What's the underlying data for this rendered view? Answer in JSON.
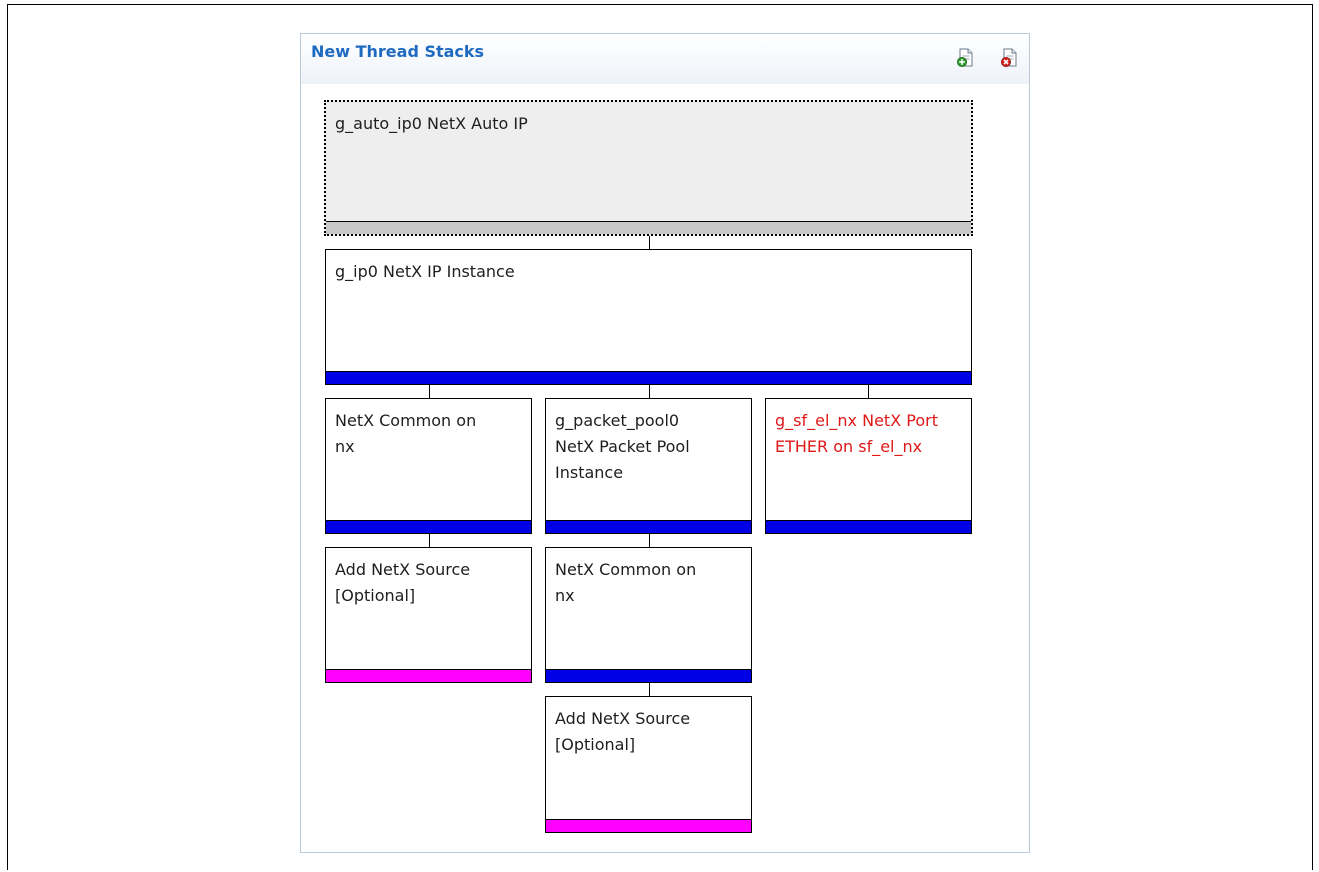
{
  "panel": {
    "title": "New Thread Stacks",
    "icons": [
      "add-stack-icon",
      "remove-stack-icon"
    ]
  },
  "colors": {
    "bar_required": "#0000e6",
    "bar_optional": "#ff00ff",
    "bar_selected": "#c8c8c8",
    "error_text": "#e01818",
    "title": "#1f6bc1"
  },
  "stacks": [
    {
      "label": "g_auto_ip0 NetX Auto IP",
      "bar": "selected"
    },
    {
      "label": "g_ip0 NetX IP Instance",
      "bar": "required"
    },
    {
      "label": "NetX Common on\nnx",
      "bar": "required"
    },
    {
      "label": "g_packet_pool0\nNetX Packet Pool\nInstance",
      "bar": "required"
    },
    {
      "label": "g_sf_el_nx NetX Port\nETHER on sf_el_nx",
      "bar": "required",
      "error": true
    },
    {
      "label": "Add NetX Source\n[Optional]",
      "bar": "optional"
    },
    {
      "label": "NetX Common on\nnx",
      "bar": "required"
    },
    {
      "label": "Add NetX Source\n[Optional]",
      "bar": "optional"
    }
  ]
}
